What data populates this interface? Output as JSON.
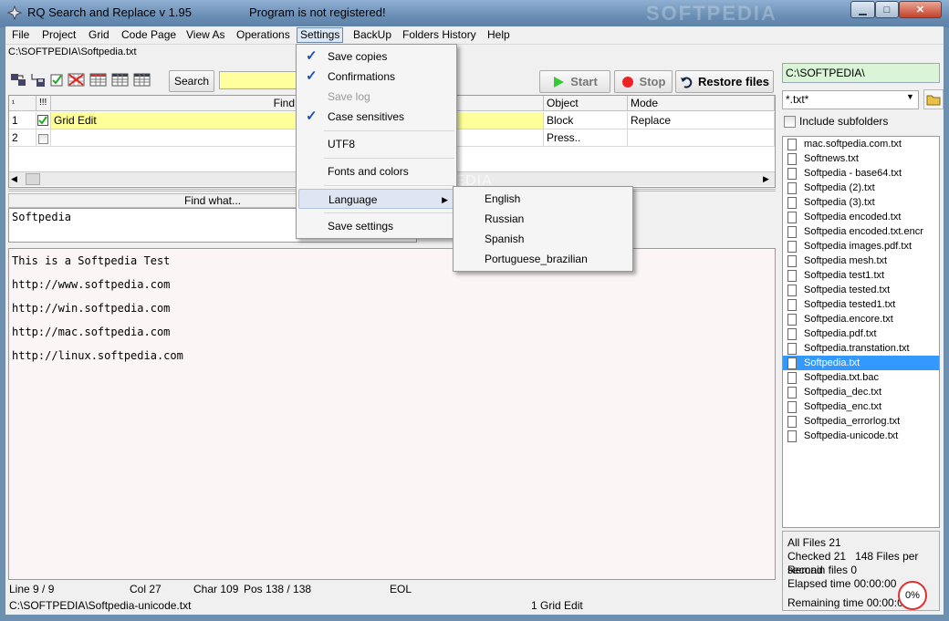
{
  "window": {
    "title": "RQ Search and Replace v 1.95",
    "registration": "Program is not registered!",
    "watermark": "SOFTPEDIA"
  },
  "menubar": {
    "items": [
      "File",
      "Project",
      "Grid",
      "Code Page",
      "View As",
      "Operations",
      "Settings",
      "BackUp",
      "Folders History",
      "Help"
    ]
  },
  "path_bar": "C:\\SOFTPEDIA\\Softpedia.txt",
  "toolbar": {
    "search_label": "Search",
    "search_value": "",
    "start_label": "Start",
    "stop_label": "Stop",
    "restore_label": "Restore files"
  },
  "grid": {
    "headers": [
      "¹",
      "!!!",
      "Find What",
      "Object",
      "Mode"
    ],
    "rows": [
      {
        "num": "1",
        "checked": true,
        "find": "Grid Edit",
        "object": "Block",
        "mode": "Replace"
      },
      {
        "num": "2",
        "checked": false,
        "find": "",
        "object": "Press..",
        "mode": ""
      }
    ]
  },
  "find_panel": {
    "label": "Find what...",
    "value": "Softpedia"
  },
  "content_lines": [
    "This is a Softpedia Test",
    "http://www.softpedia.com",
    "http://win.softpedia.com",
    "http://mac.softpedia.com",
    "http://linux.softpedia.com"
  ],
  "status": {
    "line": "Line 9 / 9",
    "col": "Col 27",
    "char": "Char 109",
    "pos": "Pos 138 / 138",
    "eol": "EOL",
    "file": "C:\\SOFTPEDIA\\Softpedia-unicode.txt",
    "grid": "1 Grid Edit"
  },
  "right_panel": {
    "folder": "C:\\SOFTPEDIA\\",
    "filter": "*.txt*",
    "include_subfolders": "Include subfolders",
    "files": [
      "mac.softpedia.com.txt",
      "Softnews.txt",
      "Softpedia - base64.txt",
      "Softpedia (2).txt",
      "Softpedia (3).txt",
      "Softpedia encoded.txt",
      "Softpedia encoded.txt.encr",
      "Softpedia images.pdf.txt",
      "Softpedia mesh.txt",
      "Softpedia test1.txt",
      "Softpedia tested.txt",
      "Softpedia tested1.txt",
      "Softpedia.encore.txt",
      "Softpedia.pdf.txt",
      "Softpedia.transtation.txt",
      "Softpedia.txt",
      "Softpedia.txt.bac",
      "Softpedia_dec.txt",
      "Softpedia_enc.txt",
      "Softpedia_errorlog.txt",
      "Softpedia-unicode.txt"
    ],
    "selected_file": "Softpedia.txt"
  },
  "stats": {
    "all_files": "All Files 21",
    "checked": "Checked 21",
    "per_second": "148 Files per second",
    "remain": "Remain files 0",
    "elapsed": "Elapsed time 00:00:00",
    "remaining": "Remaining time 00:00:00",
    "percent": "0%"
  },
  "settings_menu": {
    "items": [
      {
        "label": "Save copies",
        "checked": true,
        "enabled": true
      },
      {
        "label": "Confirmations",
        "checked": true,
        "enabled": true
      },
      {
        "label": "Save log",
        "checked": false,
        "enabled": false
      },
      {
        "label": "Case sensitives",
        "checked": true,
        "enabled": true
      },
      {
        "label": "UTF8",
        "checked": false,
        "enabled": true
      },
      {
        "label": "Fonts and colors",
        "checked": false,
        "enabled": true
      },
      {
        "label": "Language",
        "checked": false,
        "enabled": true
      },
      {
        "label": "Save settings",
        "checked": false,
        "enabled": true
      }
    ]
  },
  "language_menu": {
    "items": [
      "English",
      "Russian",
      "Spanish",
      "Portuguese_brazilian"
    ]
  },
  "colors": {
    "highlight": "#3399ff",
    "grid_row_active": "#ffff99",
    "folder_bg": "#d9f4d6",
    "content_bg": "#fbf5f5"
  }
}
